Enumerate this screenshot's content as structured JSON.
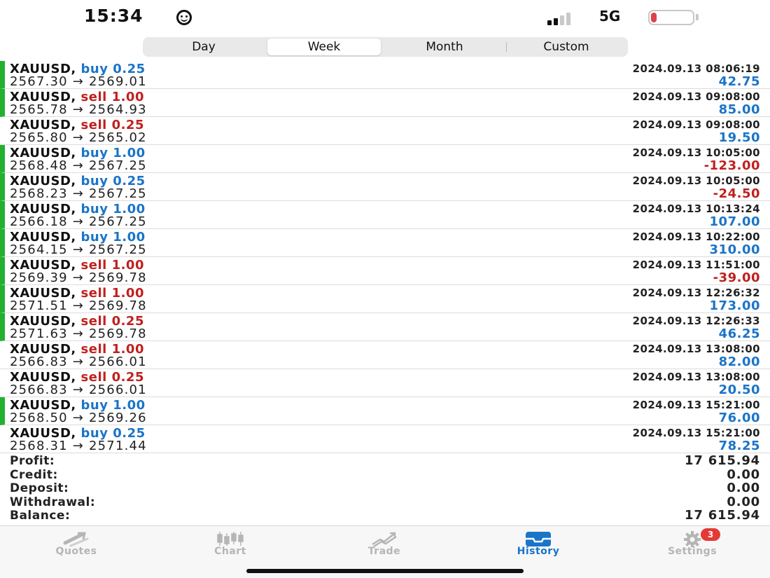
{
  "status_bar": {
    "time": "15:34",
    "network": "5G",
    "battery": "11",
    "battery_fraction": 0.11,
    "signal_bars_active": 2
  },
  "period_tabs": {
    "items": [
      {
        "label": "Day",
        "active": false
      },
      {
        "label": "Week",
        "active": true
      },
      {
        "label": "Month",
        "active": false
      },
      {
        "label": "Custom",
        "active": false
      }
    ]
  },
  "colors": {
    "buy": "#1a74c8",
    "sell": "#c0201f",
    "profit_positive": "#1a74c8",
    "profit_negative": "#c0201f",
    "marker": "#22b030",
    "accent": "#1a74c8",
    "badge": "#e53935"
  },
  "deals": [
    {
      "symbol": "XAUUSD,",
      "side": "buy",
      "volume": "0.25",
      "open": "2567.30",
      "close": "2569.01",
      "time": "2024.09.13 08:06:19",
      "profit": "42.75",
      "marked": true
    },
    {
      "symbol": "XAUUSD,",
      "side": "sell",
      "volume": "1.00",
      "open": "2565.78",
      "close": "2564.93",
      "time": "2024.09.13 09:08:00",
      "profit": "85.00",
      "marked": true
    },
    {
      "symbol": "XAUUSD,",
      "side": "sell",
      "volume": "0.25",
      "open": "2565.80",
      "close": "2565.02",
      "time": "2024.09.13 09:08:00",
      "profit": "19.50",
      "marked": false
    },
    {
      "symbol": "XAUUSD,",
      "side": "buy",
      "volume": "1.00",
      "open": "2568.48",
      "close": "2567.25",
      "time": "2024.09.13 10:05:00",
      "profit": "-123.00",
      "marked": true
    },
    {
      "symbol": "XAUUSD,",
      "side": "buy",
      "volume": "0.25",
      "open": "2568.23",
      "close": "2567.25",
      "time": "2024.09.13 10:05:00",
      "profit": "-24.50",
      "marked": true
    },
    {
      "symbol": "XAUUSD,",
      "side": "buy",
      "volume": "1.00",
      "open": "2566.18",
      "close": "2567.25",
      "time": "2024.09.13 10:13:24",
      "profit": "107.00",
      "marked": true
    },
    {
      "symbol": "XAUUSD,",
      "side": "buy",
      "volume": "1.00",
      "open": "2564.15",
      "close": "2567.25",
      "time": "2024.09.13 10:22:00",
      "profit": "310.00",
      "marked": true
    },
    {
      "symbol": "XAUUSD,",
      "side": "sell",
      "volume": "1.00",
      "open": "2569.39",
      "close": "2569.78",
      "time": "2024.09.13 11:51:00",
      "profit": "-39.00",
      "marked": true
    },
    {
      "symbol": "XAUUSD,",
      "side": "sell",
      "volume": "1.00",
      "open": "2571.51",
      "close": "2569.78",
      "time": "2024.09.13 12:26:32",
      "profit": "173.00",
      "marked": true
    },
    {
      "symbol": "XAUUSD,",
      "side": "sell",
      "volume": "0.25",
      "open": "2571.63",
      "close": "2569.78",
      "time": "2024.09.13 12:26:33",
      "profit": "46.25",
      "marked": true
    },
    {
      "symbol": "XAUUSD,",
      "side": "sell",
      "volume": "1.00",
      "open": "2566.83",
      "close": "2566.01",
      "time": "2024.09.13 13:08:00",
      "profit": "82.00",
      "marked": false
    },
    {
      "symbol": "XAUUSD,",
      "side": "sell",
      "volume": "0.25",
      "open": "2566.83",
      "close": "2566.01",
      "time": "2024.09.13 13:08:00",
      "profit": "20.50",
      "marked": false
    },
    {
      "symbol": "XAUUSD,",
      "side": "buy",
      "volume": "1.00",
      "open": "2568.50",
      "close": "2569.26",
      "time": "2024.09.13 15:21:00",
      "profit": "76.00",
      "marked": true
    },
    {
      "symbol": "XAUUSD,",
      "side": "buy",
      "volume": "0.25",
      "open": "2568.31",
      "close": "2571.44",
      "time": "2024.09.13 15:21:00",
      "profit": "78.25",
      "marked": false
    }
  ],
  "arrow": "→",
  "summary": [
    {
      "label": "Profit:",
      "value": "17 615.94"
    },
    {
      "label": "Credit:",
      "value": "0.00"
    },
    {
      "label": "Deposit:",
      "value": "0.00"
    },
    {
      "label": "Withdrawal:",
      "value": "0.00"
    },
    {
      "label": "Balance:",
      "value": "17 615.94"
    }
  ],
  "tab_bar": {
    "items": [
      {
        "label": "Quotes",
        "icon": "quotes-icon",
        "active": false
      },
      {
        "label": "Chart",
        "icon": "candlestick-chart-icon",
        "active": false
      },
      {
        "label": "Trade",
        "icon": "trade-icon",
        "active": false
      },
      {
        "label": "History",
        "icon": "history-inbox-icon",
        "active": true
      },
      {
        "label": "Settings",
        "icon": "gear-icon",
        "active": false,
        "badge": "3"
      }
    ]
  }
}
